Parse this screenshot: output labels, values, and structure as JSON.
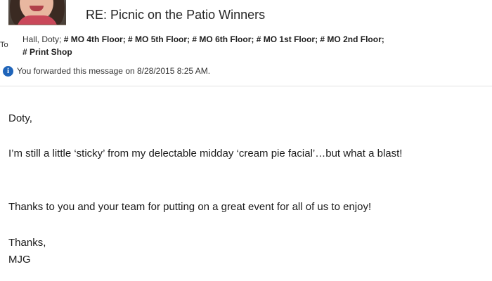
{
  "message": {
    "subject": "RE: Picnic on the Patio Winners",
    "to_label": "To",
    "recipients": [
      {
        "text": "Hall, Doty;",
        "group": false
      },
      {
        "text": "# MO 4th Floor;",
        "group": true
      },
      {
        "text": "# MO 5th Floor;",
        "group": true
      },
      {
        "text": "# MO 6th Floor;",
        "group": true
      },
      {
        "text": "# MO 1st Floor;",
        "group": true
      },
      {
        "text": "# MO 2nd Floor;",
        "group": true
      },
      {
        "text": "# Print Shop",
        "group": true
      }
    ],
    "info_text": "You forwarded this message on 8/28/2015 8:25 AM."
  },
  "body": {
    "greeting": "Doty,",
    "paragraph1": "I’m still a little ‘sticky’ from my delectable midday ‘cream pie facial’…but what a blast!",
    "paragraph2": "Thanks to you and your team for putting on a great event for all of us to enjoy!",
    "closing": "Thanks,",
    "signature": "MJG"
  }
}
